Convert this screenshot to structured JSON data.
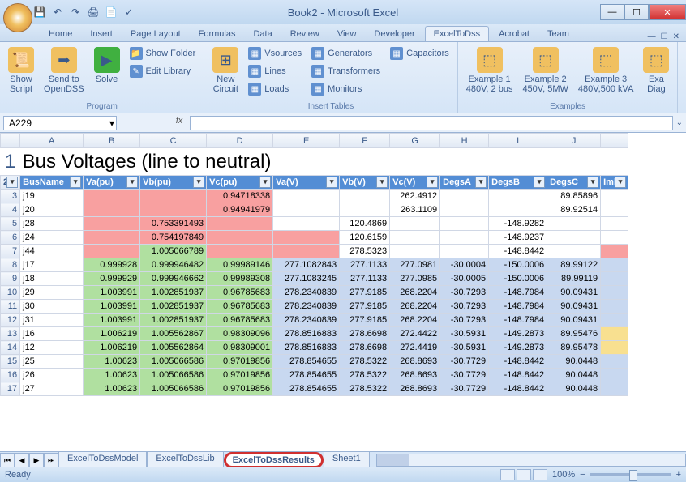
{
  "window": {
    "title": "Book2 - Microsoft Excel"
  },
  "qat": [
    "save",
    "undo",
    "redo",
    "print",
    "quick-print",
    "spelling"
  ],
  "tabs": [
    "Home",
    "Insert",
    "Page Layout",
    "Formulas",
    "Data",
    "Review",
    "View",
    "Developer",
    "ExcelToDss",
    "Acrobat",
    "Team"
  ],
  "active_tab": 8,
  "ribbon": {
    "groups": [
      {
        "label": "Program",
        "big": [
          {
            "name": "show-script",
            "label": "Show\nScript",
            "icon": "📜"
          },
          {
            "name": "send-to-opendss",
            "label": "Send to\nOpenDSS",
            "icon": "➡"
          },
          {
            "name": "solve",
            "label": "Solve",
            "icon": "▶",
            "color": "#40b040"
          }
        ],
        "small": [
          {
            "name": "show-folder",
            "label": "Show Folder",
            "icon": "📁"
          },
          {
            "name": "edit-library",
            "label": "Edit Library",
            "icon": "✎"
          }
        ]
      },
      {
        "label": "Insert Tables",
        "big": [
          {
            "name": "new-circuit",
            "label": "New\nCircuit",
            "icon": "⊞"
          }
        ],
        "cols": [
          [
            {
              "name": "vsources",
              "label": "Vsources"
            },
            {
              "name": "lines",
              "label": "Lines"
            },
            {
              "name": "loads",
              "label": "Loads"
            }
          ],
          [
            {
              "name": "generators",
              "label": "Generators"
            },
            {
              "name": "transformers",
              "label": "Transformers"
            },
            {
              "name": "monitors",
              "label": "Monitors"
            }
          ],
          [
            {
              "name": "capacitors",
              "label": "Capacitors"
            }
          ]
        ]
      },
      {
        "label": "Examples",
        "big": [
          {
            "name": "example1",
            "label": "Example 1\n480V, 2 bus",
            "icon": "⬚"
          },
          {
            "name": "example2",
            "label": "Example 2\n450V, 5MW",
            "icon": "⬚"
          },
          {
            "name": "example3",
            "label": "Example 3\n480V,500 kVA",
            "icon": "⬚"
          },
          {
            "name": "example4",
            "label": "Exa\nDiag",
            "icon": "⬚"
          }
        ]
      }
    ]
  },
  "namebox": "A229",
  "sheet": {
    "cols": [
      "A",
      "B",
      "C",
      "D",
      "E",
      "F",
      "G",
      "H",
      "I",
      "J"
    ],
    "title": "Bus Voltages (line to neutral)",
    "headers": [
      "BusName",
      "Va(pu)",
      "Vb(pu)",
      "Vc(pu)",
      "Va(V)",
      "Vb(V)",
      "Vc(V)",
      "DegsA",
      "DegsB",
      "DegsC",
      "Iml"
    ],
    "rows": [
      {
        "n": 3,
        "name": "j19",
        "cells": [
          {
            "v": "",
            "c": "red"
          },
          {
            "v": "",
            "c": "red"
          },
          {
            "v": "0.94718338",
            "c": "red"
          },
          {
            "v": ""
          },
          {
            "v": ""
          },
          {
            "v": "262.4912"
          },
          {
            "v": ""
          },
          {
            "v": ""
          },
          {
            "v": "89.85896"
          },
          {
            "v": ""
          }
        ]
      },
      {
        "n": 4,
        "name": "j20",
        "cells": [
          {
            "v": "",
            "c": "red"
          },
          {
            "v": "",
            "c": "red"
          },
          {
            "v": "0.94941979",
            "c": "red"
          },
          {
            "v": ""
          },
          {
            "v": ""
          },
          {
            "v": "263.1109"
          },
          {
            "v": ""
          },
          {
            "v": ""
          },
          {
            "v": "89.92514"
          },
          {
            "v": ""
          }
        ]
      },
      {
        "n": 5,
        "name": "j28",
        "cells": [
          {
            "v": "",
            "c": "red"
          },
          {
            "v": "0.753391493",
            "c": "red"
          },
          {
            "v": "",
            "c": "red"
          },
          {
            "v": ""
          },
          {
            "v": "120.4869"
          },
          {
            "v": ""
          },
          {
            "v": ""
          },
          {
            "v": "-148.9282"
          },
          {
            "v": ""
          },
          {
            "v": ""
          }
        ]
      },
      {
        "n": 6,
        "name": "j24",
        "cells": [
          {
            "v": "",
            "c": "red"
          },
          {
            "v": "0.754197849",
            "c": "red"
          },
          {
            "v": "",
            "c": "red"
          },
          {
            "v": "",
            "c": "red"
          },
          {
            "v": "120.6159"
          },
          {
            "v": ""
          },
          {
            "v": ""
          },
          {
            "v": "-148.9237"
          },
          {
            "v": ""
          },
          {
            "v": ""
          }
        ]
      },
      {
        "n": 7,
        "name": "j44",
        "cells": [
          {
            "v": "",
            "c": "red"
          },
          {
            "v": "1.005066789",
            "c": "green"
          },
          {
            "v": "",
            "c": "red"
          },
          {
            "v": "",
            "c": "red"
          },
          {
            "v": "278.5323"
          },
          {
            "v": ""
          },
          {
            "v": ""
          },
          {
            "v": "-148.8442"
          },
          {
            "v": ""
          },
          {
            "v": "",
            "c": "red"
          }
        ]
      },
      {
        "n": 8,
        "name": "j17",
        "cells": [
          {
            "v": "0.999928",
            "c": "green"
          },
          {
            "v": "0.999946482",
            "c": "green"
          },
          {
            "v": "0.99989146",
            "c": "green"
          },
          {
            "v": "277.1082843",
            "c": "blue"
          },
          {
            "v": "277.1133",
            "c": "blue"
          },
          {
            "v": "277.0981",
            "c": "blue"
          },
          {
            "v": "-30.0004",
            "c": "blue"
          },
          {
            "v": "-150.0006",
            "c": "blue"
          },
          {
            "v": "89.99122",
            "c": "blue"
          },
          {
            "v": "",
            "c": "blue"
          }
        ]
      },
      {
        "n": 9,
        "name": "j18",
        "cells": [
          {
            "v": "0.999929",
            "c": "green"
          },
          {
            "v": "0.999946662",
            "c": "green"
          },
          {
            "v": "0.99989308",
            "c": "green"
          },
          {
            "v": "277.1083245",
            "c": "blue"
          },
          {
            "v": "277.1133",
            "c": "blue"
          },
          {
            "v": "277.0985",
            "c": "blue"
          },
          {
            "v": "-30.0005",
            "c": "blue"
          },
          {
            "v": "-150.0006",
            "c": "blue"
          },
          {
            "v": "89.99119",
            "c": "blue"
          },
          {
            "v": "",
            "c": "blue"
          }
        ]
      },
      {
        "n": 10,
        "name": "j29",
        "cells": [
          {
            "v": "1.003991",
            "c": "green"
          },
          {
            "v": "1.002851937",
            "c": "green"
          },
          {
            "v": "0.96785683",
            "c": "green"
          },
          {
            "v": "278.2340839",
            "c": "blue"
          },
          {
            "v": "277.9185",
            "c": "blue"
          },
          {
            "v": "268.2204",
            "c": "blue"
          },
          {
            "v": "-30.7293",
            "c": "blue"
          },
          {
            "v": "-148.7984",
            "c": "blue"
          },
          {
            "v": "90.09431",
            "c": "blue"
          },
          {
            "v": "",
            "c": "blue"
          }
        ]
      },
      {
        "n": 11,
        "name": "j30",
        "cells": [
          {
            "v": "1.003991",
            "c": "green"
          },
          {
            "v": "1.002851937",
            "c": "green"
          },
          {
            "v": "0.96785683",
            "c": "green"
          },
          {
            "v": "278.2340839",
            "c": "blue"
          },
          {
            "v": "277.9185",
            "c": "blue"
          },
          {
            "v": "268.2204",
            "c": "blue"
          },
          {
            "v": "-30.7293",
            "c": "blue"
          },
          {
            "v": "-148.7984",
            "c": "blue"
          },
          {
            "v": "90.09431",
            "c": "blue"
          },
          {
            "v": "",
            "c": "blue"
          }
        ]
      },
      {
        "n": 12,
        "name": "j31",
        "cells": [
          {
            "v": "1.003991",
            "c": "green"
          },
          {
            "v": "1.002851937",
            "c": "green"
          },
          {
            "v": "0.96785683",
            "c": "green"
          },
          {
            "v": "278.2340839",
            "c": "blue"
          },
          {
            "v": "277.9185",
            "c": "blue"
          },
          {
            "v": "268.2204",
            "c": "blue"
          },
          {
            "v": "-30.7293",
            "c": "blue"
          },
          {
            "v": "-148.7984",
            "c": "blue"
          },
          {
            "v": "90.09431",
            "c": "blue"
          },
          {
            "v": "",
            "c": "blue"
          }
        ]
      },
      {
        "n": 13,
        "name": "j16",
        "cells": [
          {
            "v": "1.006219",
            "c": "green"
          },
          {
            "v": "1.005562867",
            "c": "green"
          },
          {
            "v": "0.98309096",
            "c": "green"
          },
          {
            "v": "278.8516883",
            "c": "blue"
          },
          {
            "v": "278.6698",
            "c": "blue"
          },
          {
            "v": "272.4422",
            "c": "blue"
          },
          {
            "v": "-30.5931",
            "c": "blue"
          },
          {
            "v": "-149.2873",
            "c": "blue"
          },
          {
            "v": "89.95476",
            "c": "blue"
          },
          {
            "v": "",
            "c": "yellow"
          }
        ]
      },
      {
        "n": 14,
        "name": "j12",
        "cells": [
          {
            "v": "1.006219",
            "c": "green"
          },
          {
            "v": "1.005562864",
            "c": "green"
          },
          {
            "v": "0.98309001",
            "c": "green"
          },
          {
            "v": "278.8516883",
            "c": "blue"
          },
          {
            "v": "278.6698",
            "c": "blue"
          },
          {
            "v": "272.4419",
            "c": "blue"
          },
          {
            "v": "-30.5931",
            "c": "blue"
          },
          {
            "v": "-149.2873",
            "c": "blue"
          },
          {
            "v": "89.95478",
            "c": "blue"
          },
          {
            "v": "",
            "c": "yellow"
          }
        ]
      },
      {
        "n": 15,
        "name": "j25",
        "cells": [
          {
            "v": "1.00623",
            "c": "green"
          },
          {
            "v": "1.005066586",
            "c": "green"
          },
          {
            "v": "0.97019856",
            "c": "green"
          },
          {
            "v": "278.854655",
            "c": "blue"
          },
          {
            "v": "278.5322",
            "c": "blue"
          },
          {
            "v": "268.8693",
            "c": "blue"
          },
          {
            "v": "-30.7729",
            "c": "blue"
          },
          {
            "v": "-148.8442",
            "c": "blue"
          },
          {
            "v": "90.0448",
            "c": "blue"
          },
          {
            "v": "",
            "c": "blue"
          }
        ]
      },
      {
        "n": 16,
        "name": "j26",
        "cells": [
          {
            "v": "1.00623",
            "c": "green"
          },
          {
            "v": "1.005066586",
            "c": "green"
          },
          {
            "v": "0.97019856",
            "c": "green"
          },
          {
            "v": "278.854655",
            "c": "blue"
          },
          {
            "v": "278.5322",
            "c": "blue"
          },
          {
            "v": "268.8693",
            "c": "blue"
          },
          {
            "v": "-30.7729",
            "c": "blue"
          },
          {
            "v": "-148.8442",
            "c": "blue"
          },
          {
            "v": "90.0448",
            "c": "blue"
          },
          {
            "v": "",
            "c": "blue"
          }
        ]
      },
      {
        "n": 17,
        "name": "j27",
        "cells": [
          {
            "v": "1.00623",
            "c": "green"
          },
          {
            "v": "1.005066586",
            "c": "green"
          },
          {
            "v": "0.97019856",
            "c": "green"
          },
          {
            "v": "278.854655",
            "c": "blue"
          },
          {
            "v": "278.5322",
            "c": "blue"
          },
          {
            "v": "268.8693",
            "c": "blue"
          },
          {
            "v": "-30.7729",
            "c": "blue"
          },
          {
            "v": "-148.8442",
            "c": "blue"
          },
          {
            "v": "90.0448",
            "c": "blue"
          },
          {
            "v": "",
            "c": "blue"
          }
        ]
      }
    ]
  },
  "sheet_tabs": [
    "ExcelToDssModel",
    "ExcelToDssLib",
    "ExcelToDssResults",
    "Sheet1"
  ],
  "active_sheet": 2,
  "status": "Ready",
  "zoom": "100%"
}
